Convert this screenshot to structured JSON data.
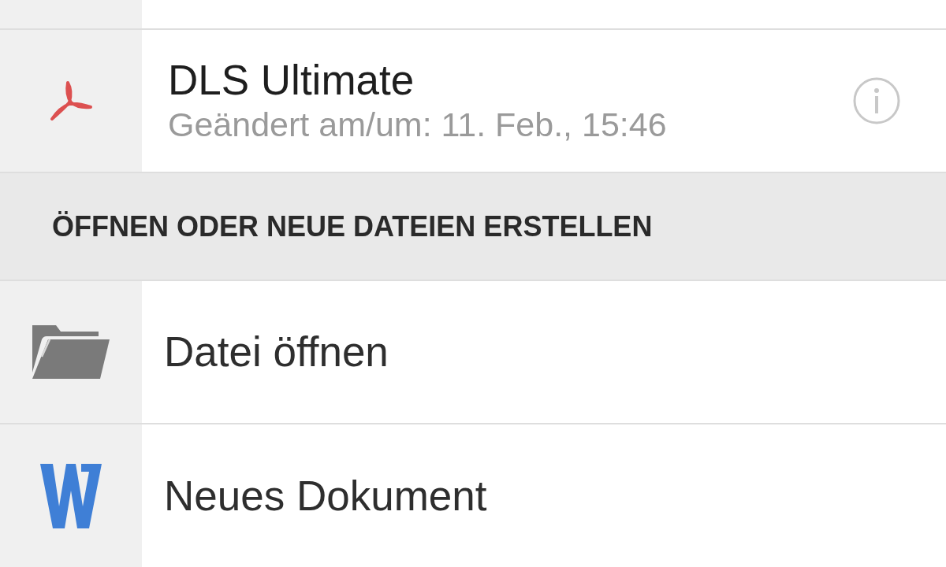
{
  "recent_files": [
    {
      "name": "DLS Ultimate",
      "modified": "Geändert am/um: 11. Feb., 15:46",
      "kind": "pdf"
    }
  ],
  "section": {
    "title": "ÖFFNEN ODER NEUE DATEIEN ERSTELLEN"
  },
  "actions": [
    {
      "label": "Datei öffnen",
      "kind": "open"
    },
    {
      "label": "Neues Dokument",
      "kind": "document"
    }
  ]
}
